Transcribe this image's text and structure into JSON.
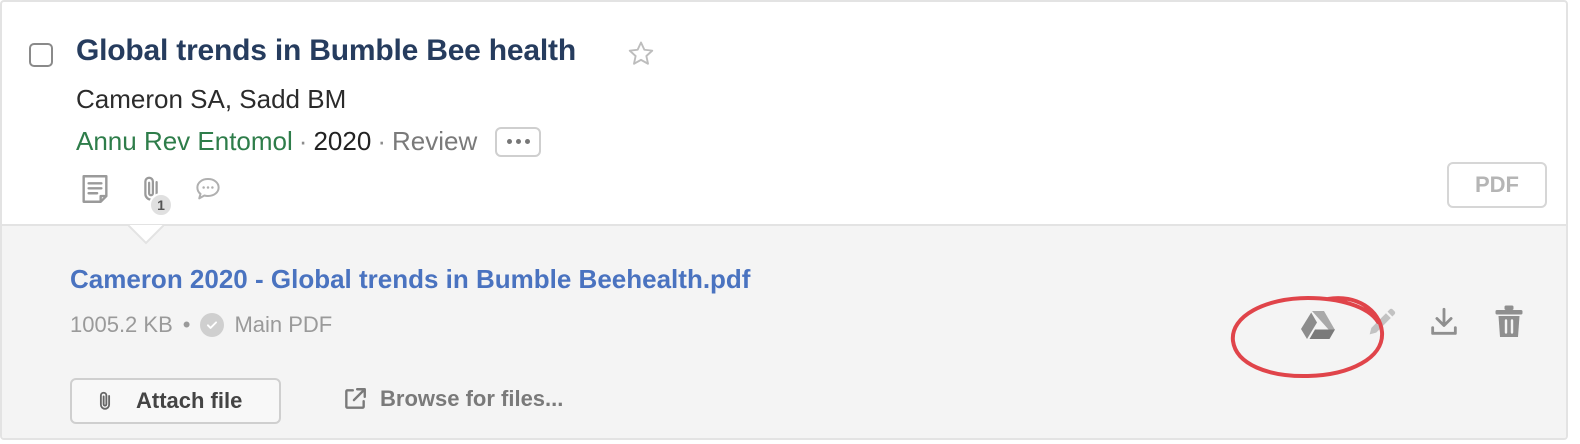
{
  "paper": {
    "title": "Global trends in Bumble Bee health",
    "authors": "Cameron SA, Sadd BM",
    "journal": "Annu Rev Entomol",
    "year": "2020",
    "pub_type": "Review",
    "separator": "·"
  },
  "toolbar": {
    "attachment_count": "1",
    "pdf_label": "PDF"
  },
  "attachment": {
    "filename": "Cameron 2020 - Global trends in Bumble Beehealth.pdf",
    "size": "1005.2 KB",
    "separator": "•",
    "status": "Main PDF"
  },
  "actions": {
    "attach_label": "Attach file",
    "browse_label": "Browse for files..."
  },
  "icons": {
    "checkbox": "checkbox-icon",
    "star": "star-icon",
    "more": "more-horizontal-icon",
    "notes": "notes-icon",
    "attachments": "paperclip-icon",
    "comments": "comment-icon",
    "check": "check-circle-icon",
    "google_drive": "google-drive-icon",
    "edit": "pencil-icon",
    "download": "download-icon",
    "delete": "trash-icon",
    "external": "external-link-icon"
  },
  "colors": {
    "title": "#263c5e",
    "journal": "#2e7d4a",
    "file_link": "#4a73c0",
    "annotation": "#e0444a",
    "panel_bg": "#f4f4f4"
  }
}
